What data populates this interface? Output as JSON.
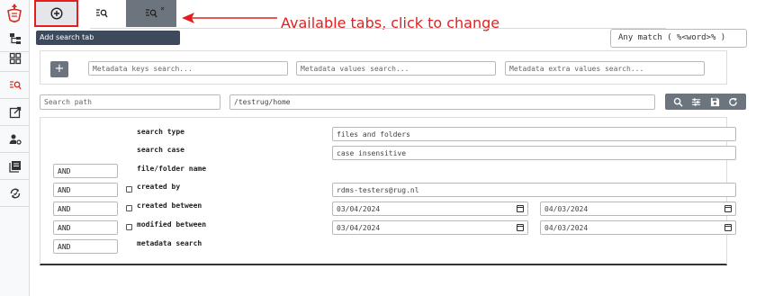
{
  "tabs": {
    "add_tooltip": "Add search tab",
    "close_label": "×"
  },
  "annotation": {
    "text": "Available tabs, click to change"
  },
  "match_mode": {
    "value": "Any match ( %<word>% )"
  },
  "metadata": {
    "add_label": "+",
    "keys_placeholder": "Metadata keys search...",
    "values_placeholder": "Metadata values search...",
    "extra_placeholder": "Metadata extra values search..."
  },
  "path": {
    "placeholder": "Search path",
    "value": "/testrug/home"
  },
  "filters": {
    "search_type_label": "search type",
    "search_type_value": "files and folders",
    "search_case_label": "search case",
    "search_case_value": "case insensitive",
    "name_label": "file/folder name",
    "name_op": "AND",
    "created_by_label": "created by",
    "created_by_op": "AND",
    "created_by_value": "rdms-testers@rug.nl",
    "created_between_label": "created between",
    "created_between_op": "AND",
    "created_from": "03/04/2024",
    "created_to": "04/03/2024",
    "modified_between_label": "modified between",
    "modified_between_op": "AND",
    "modified_from": "03/04/2024",
    "modified_to": "04/03/2024",
    "metadata_search_label": "metadata search",
    "metadata_search_op": "AND"
  },
  "colors": {
    "accent_red": "#e41e1e",
    "toolbar_gray": "#6c757d",
    "tooltip_bg": "#3d4a5c"
  },
  "icons": {
    "sidebar": [
      "logo-icon",
      "tree-icon",
      "grid-icon",
      "search-list-icon",
      "external-link-icon",
      "user-settings-icon",
      "collection-icon",
      "sync-icon"
    ],
    "toolbar": [
      "search-icon",
      "sliders-icon",
      "save-icon",
      "refresh-icon"
    ]
  }
}
